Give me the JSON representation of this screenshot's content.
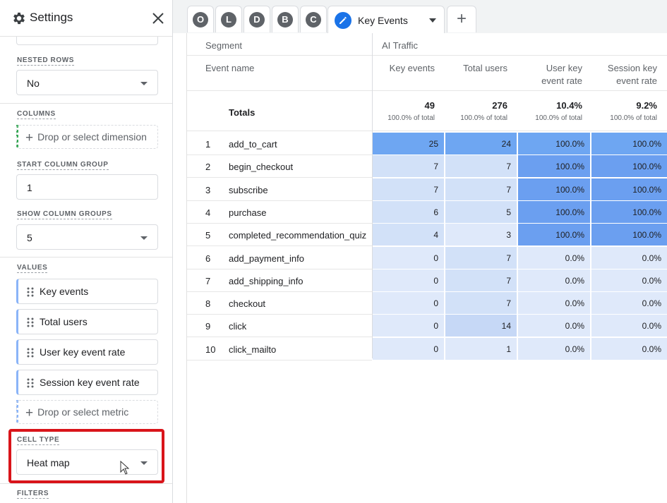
{
  "settings": {
    "title": "Settings",
    "nested_rows": {
      "label": "NESTED ROWS",
      "value": "No"
    },
    "columns": {
      "label": "COLUMNS",
      "drop_text": "Drop or select dimension"
    },
    "start_column_group": {
      "label": "START COLUMN GROUP",
      "value": "1"
    },
    "show_column_groups": {
      "label": "SHOW COLUMN GROUPS",
      "value": "5"
    },
    "values": {
      "label": "VALUES",
      "metrics": [
        "Key events",
        "Total users",
        "User key event rate",
        "Session key event rate"
      ],
      "drop_text": "Drop or select metric"
    },
    "cell_type": {
      "label": "CELL TYPE",
      "value": "Heat map"
    },
    "filters": {
      "label": "FILTERS"
    }
  },
  "tabs": {
    "letters": [
      "O",
      "L",
      "D",
      "B",
      "C"
    ],
    "active": "Key Events",
    "add": "+"
  },
  "table": {
    "segment_header": "Segment",
    "segment_name": "AI Traffic",
    "event_name_header": "Event name",
    "columns": [
      {
        "line1": "Key events",
        "line2": ""
      },
      {
        "line1": "Total users",
        "line2": ""
      },
      {
        "line1": "User key",
        "line2": "event rate"
      },
      {
        "line1": "Session key",
        "line2": "event rate"
      }
    ],
    "totals_label": "Totals",
    "totals": [
      {
        "value": "49",
        "sub": "100.0% of total"
      },
      {
        "value": "276",
        "sub": "100.0% of total"
      },
      {
        "value": "10.4%",
        "sub": "100.0% of total"
      },
      {
        "value": "9.2%",
        "sub": "100.0% of total"
      }
    ],
    "rows": [
      {
        "num": "1",
        "event": "add_to_cart",
        "values": [
          "25",
          "24",
          "100.0%",
          "100.0%"
        ]
      },
      {
        "num": "2",
        "event": "begin_checkout",
        "values": [
          "7",
          "7",
          "100.0%",
          "100.0%"
        ]
      },
      {
        "num": "3",
        "event": "subscribe",
        "values": [
          "7",
          "7",
          "100.0%",
          "100.0%"
        ]
      },
      {
        "num": "4",
        "event": "purchase",
        "values": [
          "6",
          "5",
          "100.0%",
          "100.0%"
        ]
      },
      {
        "num": "5",
        "event": "completed_recommendation_quiz",
        "values": [
          "4",
          "3",
          "100.0%",
          "100.0%"
        ]
      },
      {
        "num": "6",
        "event": "add_payment_info",
        "values": [
          "0",
          "7",
          "0.0%",
          "0.0%"
        ]
      },
      {
        "num": "7",
        "event": "add_shipping_info",
        "values": [
          "0",
          "7",
          "0.0%",
          "0.0%"
        ]
      },
      {
        "num": "8",
        "event": "checkout",
        "values": [
          "0",
          "7",
          "0.0%",
          "0.0%"
        ]
      },
      {
        "num": "9",
        "event": "click",
        "values": [
          "0",
          "14",
          "0.0%",
          "0.0%"
        ]
      },
      {
        "num": "10",
        "event": "click_mailto",
        "values": [
          "0",
          "1",
          "0.0%",
          "0.0%"
        ]
      }
    ],
    "heat_colors": {
      "strong": "#6ea6f2",
      "high": "#6b9ff0",
      "medium": "#c6d8f6",
      "light": "#d2e1f8",
      "faint": "#dfe9fa"
    }
  },
  "colors": {
    "highlight_border": "#d9141a",
    "accent_blue": "#1a73e8"
  }
}
